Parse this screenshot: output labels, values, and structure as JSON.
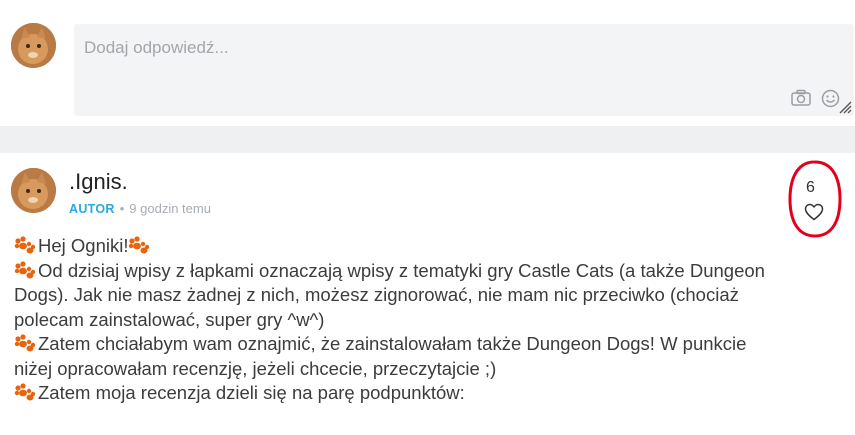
{
  "reply": {
    "placeholder": "Dodaj odpowiedź..."
  },
  "post": {
    "author": ".Ignis.",
    "badge": "AUTOR",
    "separator": "•",
    "time": "9 godzin temu",
    "likes": "6",
    "lines": [
      "Hej Ogniki!",
      "Od dzisiaj wpisy z łapkami oznaczają wpisy z tematyki gry Castle Cats (a także Dungeon",
      "Dogs). Jak nie masz żadnej z nich, możesz zignorować, nie mam nic przeciwko (chociaż",
      "polecam zainstalować, super gry ^w^)",
      "Zatem chciałabym wam oznajmić, że zainstalowałam także Dungeon Dogs! W punkcie",
      "niżej opracowałam recenzję, jeżeli chcecie, przeczytajcie ;)",
      "Zatem moja recenzja dzieli się na parę podpunktów:"
    ]
  },
  "colors": {
    "accent": "#2aa8e0",
    "annotation": "#e3001b",
    "paw": "#e8650e"
  }
}
